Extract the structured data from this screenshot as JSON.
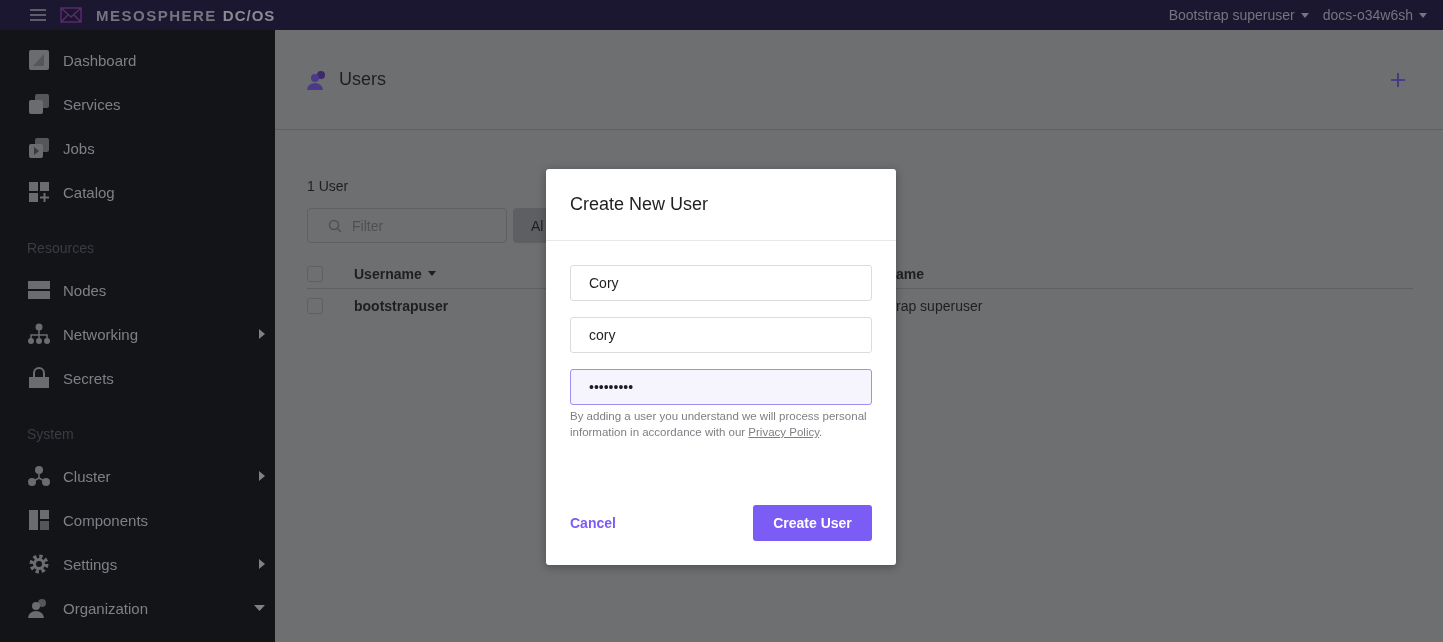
{
  "topbar": {
    "brand": "MESOSPHERE",
    "brand_suffix": "DC/OS",
    "user_menu": "Bootstrap superuser",
    "cluster_menu": "docs-o34w6sh"
  },
  "sidebar": {
    "groups": [
      {
        "items": [
          {
            "label": "Dashboard",
            "kind": "link"
          },
          {
            "label": "Services",
            "kind": "link"
          },
          {
            "label": "Jobs",
            "kind": "link"
          },
          {
            "label": "Catalog",
            "kind": "link"
          }
        ]
      },
      {
        "heading": "Resources",
        "items": [
          {
            "label": "Nodes",
            "kind": "link"
          },
          {
            "label": "Networking",
            "kind": "submenu",
            "expanded": false
          },
          {
            "label": "Secrets",
            "kind": "link"
          }
        ]
      },
      {
        "heading": "System",
        "items": [
          {
            "label": "Cluster",
            "kind": "submenu",
            "expanded": false
          },
          {
            "label": "Components",
            "kind": "link"
          },
          {
            "label": "Settings",
            "kind": "submenu",
            "expanded": false
          },
          {
            "label": "Organization",
            "kind": "submenu",
            "expanded": true
          }
        ]
      }
    ]
  },
  "page": {
    "title": "Users",
    "count": "1 User",
    "filter": {
      "placeholder": "Filter"
    },
    "filter_button": "Al",
    "table": {
      "all_checked": false,
      "columns": [
        "Username",
        "ame"
      ],
      "rows": [
        {
          "checked": false,
          "cells": [
            "bootstrapuser",
            "rap superuser"
          ]
        }
      ]
    }
  },
  "modal": {
    "title": "Create New User",
    "fields": [
      {
        "value": "Cory",
        "focused": false
      },
      {
        "value": "cory",
        "focused": false
      },
      {
        "value": "•••••••••",
        "focused": true
      }
    ],
    "disclaimer": "By adding a user you understand we will process personal information in accordance with our",
    "link": "Privacy Policy",
    "disclaimer_end": ".",
    "cancel": "Cancel",
    "submit": "Create User"
  }
}
